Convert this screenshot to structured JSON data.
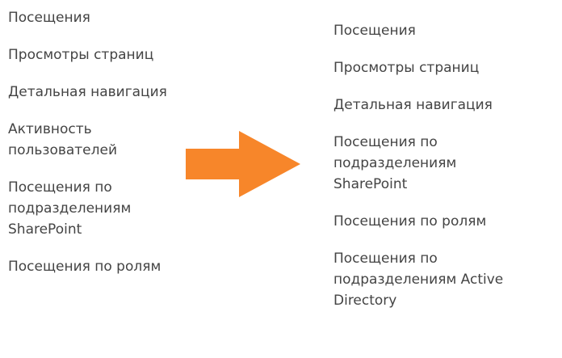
{
  "before_menu": {
    "items": [
      {
        "label": "Посещения"
      },
      {
        "label": "Просмотры страниц"
      },
      {
        "label": "Детальная навигация"
      },
      {
        "label": "Активность\nпользователей"
      },
      {
        "label": "Посещения по\nподразделениям\nSharePoint"
      },
      {
        "label": "Посещения по ролям"
      }
    ]
  },
  "after_menu": {
    "items": [
      {
        "label": "Посещения"
      },
      {
        "label": "Просмотры страниц"
      },
      {
        "label": "Детальная навигация"
      },
      {
        "label": "Посещения по\nподразделениям\nSharePoint"
      },
      {
        "label": "Посещения по ролям"
      },
      {
        "label": "Посещения по\nподразделениям Active\nDirectory"
      }
    ]
  },
  "arrow": {
    "icon": "arrow-right-icon",
    "color": "#f7862a"
  },
  "colors": {
    "text": "#444444",
    "background": "#ffffff"
  }
}
